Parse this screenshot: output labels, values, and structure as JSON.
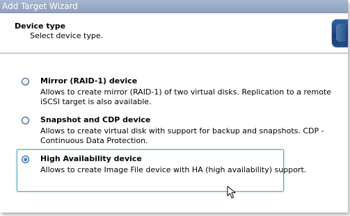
{
  "window": {
    "title": "Add Target Wizard"
  },
  "header": {
    "title": "Device type",
    "subtitle": "Select device type."
  },
  "options": [
    {
      "label": "Mirror (RAID-1) device",
      "description": "Allows to create mirror (RAID-1) of two virtual disks. Replication to a remote iSCSI target is also available.",
      "selected": false
    },
    {
      "label": "Snapshot and CDP device",
      "description": "Allows to create virtual disk with support for backup and snapshots. CDP - Continuous Data Protection.",
      "selected": false
    },
    {
      "label": "High Availability device",
      "description": "Allows to create Image File device with HA (high availability) support.",
      "selected": true
    }
  ],
  "colors": {
    "highlight": "#5aa9b9",
    "radio_border": "#1c5180",
    "radio_dot": "#1f6fcf"
  }
}
